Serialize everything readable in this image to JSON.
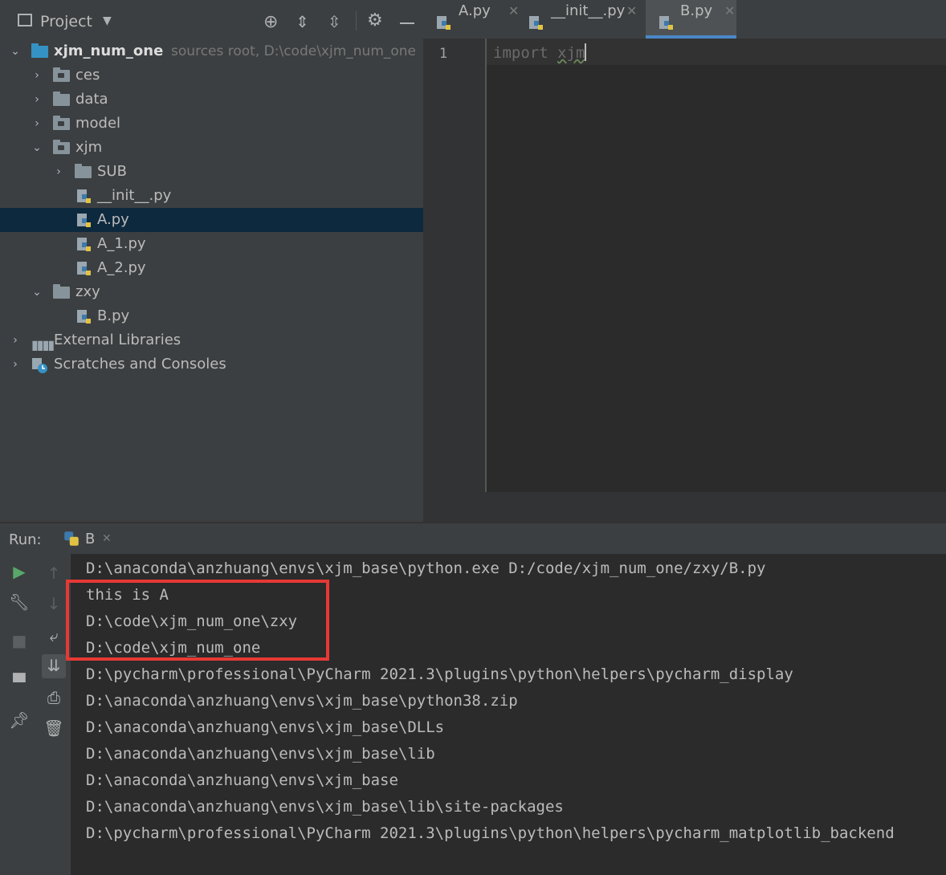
{
  "project_panel": {
    "title": "Project",
    "root": {
      "name": "xjm_num_one",
      "meta": "sources root,  D:\\code\\xjm_num_one"
    },
    "tree": [
      {
        "label": "ces"
      },
      {
        "label": "data"
      },
      {
        "label": "model"
      },
      {
        "label": "xjm"
      },
      {
        "label": "SUB"
      },
      {
        "label": "__init__.py"
      },
      {
        "label": "A.py"
      },
      {
        "label": "A_1.py"
      },
      {
        "label": "A_2.py"
      },
      {
        "label": "zxy"
      },
      {
        "label": "B.py"
      },
      {
        "label": "External Libraries"
      },
      {
        "label": "Scratches and Consoles"
      }
    ]
  },
  "editor": {
    "tabs": [
      {
        "label": "A.py"
      },
      {
        "label": "__init__.py"
      },
      {
        "label": "B.py",
        "active": true
      }
    ],
    "line_number": "1",
    "code_keyword": "import",
    "code_module": "xjm"
  },
  "run_panel": {
    "label": "Run:",
    "tab": "B",
    "output": [
      "D:\\anaconda\\anzhuang\\envs\\xjm_base\\python.exe D:/code/xjm_num_one/zxy/B.py",
      "this is A",
      "D:\\code\\xjm_num_one\\zxy",
      "D:\\code\\xjm_num_one",
      "D:\\pycharm\\professional\\PyCharm 2021.3\\plugins\\python\\helpers\\pycharm_display",
      "D:\\anaconda\\anzhuang\\envs\\xjm_base\\python38.zip",
      "D:\\anaconda\\anzhuang\\envs\\xjm_base\\DLLs",
      "D:\\anaconda\\anzhuang\\envs\\xjm_base\\lib",
      "D:\\anaconda\\anzhuang\\envs\\xjm_base",
      "D:\\anaconda\\anzhuang\\envs\\xjm_base\\lib\\site-packages",
      "D:\\pycharm\\professional\\PyCharm 2021.3\\plugins\\python\\helpers\\pycharm_matplotlib_backend"
    ]
  },
  "colors": {
    "highlight_box": "#e53935",
    "selection": "#0d293e",
    "accent": "#4a88c7"
  }
}
